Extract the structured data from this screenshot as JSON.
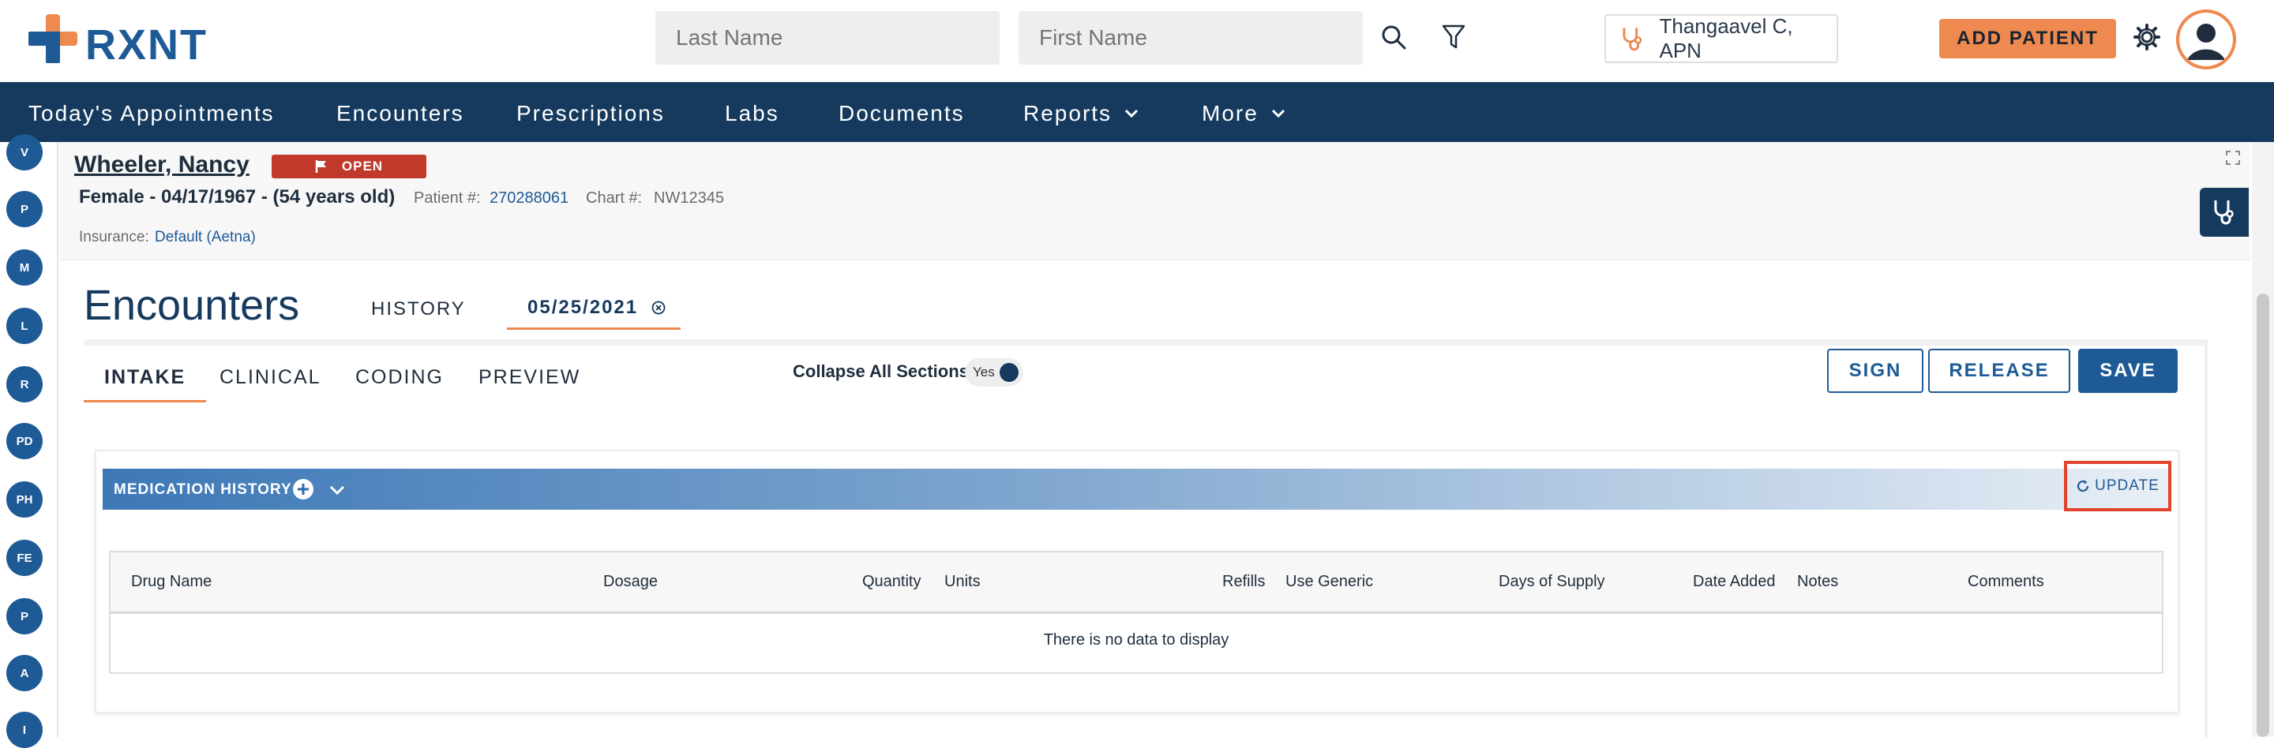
{
  "header": {
    "logo_text": "RXNT",
    "last_name_placeholder": "Last Name",
    "first_name_placeholder": "First Name",
    "provider_name": "Thangaavel C, APN",
    "add_patient_label": "ADD PATIENT",
    "brand_blue": "#1e5a96",
    "brand_orange": "#ee8a4f"
  },
  "nav": {
    "items": [
      {
        "label": "Today's Appointments"
      },
      {
        "label": "Encounters"
      },
      {
        "label": "Prescriptions"
      },
      {
        "label": "Labs"
      },
      {
        "label": "Documents"
      },
      {
        "label": "Reports"
      },
      {
        "label": "More"
      }
    ]
  },
  "rail": {
    "items": [
      "V",
      "P",
      "M",
      "L",
      "R",
      "PD",
      "PH",
      "FE",
      "P",
      "A",
      "I"
    ]
  },
  "patient": {
    "name": "Wheeler, Nancy",
    "status": "OPEN",
    "demographics": "Female - 04/17/1967 - (54 years old)",
    "patient_number_label": "Patient #:",
    "patient_number": "270288061",
    "chart_label": "Chart #:",
    "chart_number": "NW12345",
    "insurance_label": "Insurance:",
    "insurance_value": "Default (Aetna)"
  },
  "encounters": {
    "title": "Encounters",
    "history_tab": "HISTORY",
    "date_tab": "05/25/2021",
    "subtabs": [
      "INTAKE",
      "CLINICAL",
      "CODING",
      "PREVIEW"
    ],
    "active_subtab": "INTAKE",
    "collapse_label": "Collapse All Sections:",
    "collapse_value": "Yes",
    "sign_label": "SIGN",
    "release_label": "RELEASE",
    "save_label": "SAVE"
  },
  "medication_history": {
    "title": "MEDICATION HISTORY",
    "update_label": "UPDATE",
    "columns": [
      "Drug Name",
      "Dosage",
      "Quantity",
      "Units",
      "Refills",
      "Use Generic",
      "Days of Supply",
      "Date Added",
      "Notes",
      "Comments"
    ],
    "empty_message": "There is no data to display"
  }
}
